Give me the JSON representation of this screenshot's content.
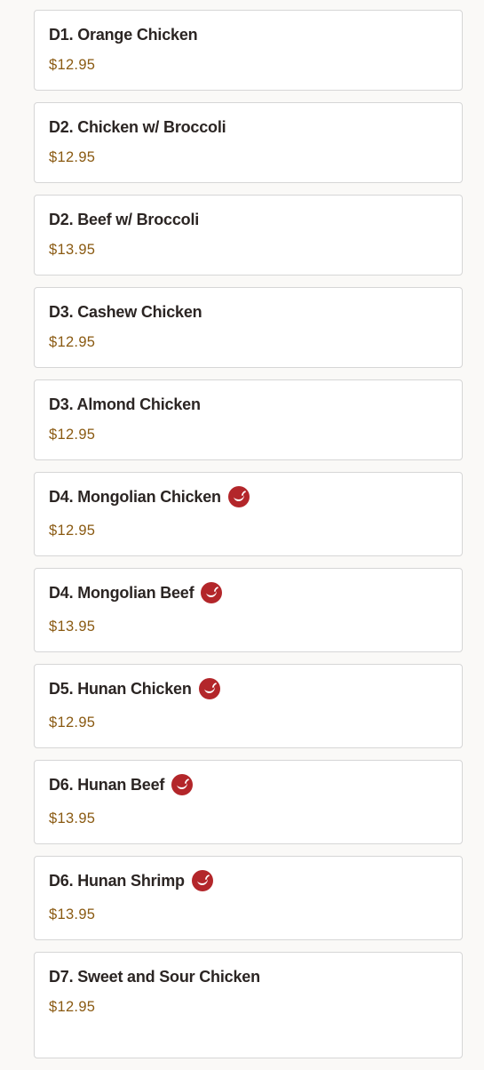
{
  "colors": {
    "background": "#faf9f7",
    "card_border": "#d6d6d6",
    "title_text": "#2b2523",
    "price_text": "#8a5a12",
    "spicy_badge": "#b3262a"
  },
  "menu": {
    "items": [
      {
        "name": "D1. Orange Chicken",
        "price": "$12.95",
        "spicy": false,
        "icon": null
      },
      {
        "name": "D2. Chicken w/ Broccoli",
        "price": "$12.95",
        "spicy": false,
        "icon": null
      },
      {
        "name": "D2. Beef w/ Broccoli",
        "price": "$13.95",
        "spicy": false,
        "icon": null
      },
      {
        "name": "D3. Cashew Chicken",
        "price": "$12.95",
        "spicy": false,
        "icon": null
      },
      {
        "name": "D3. Almond Chicken",
        "price": "$12.95",
        "spicy": false,
        "icon": null
      },
      {
        "name": "D4. Mongolian Chicken",
        "price": "$12.95",
        "spicy": true,
        "icon": "chili-pepper-icon"
      },
      {
        "name": "D4. Mongolian Beef",
        "price": "$13.95",
        "spicy": true,
        "icon": "chili-pepper-icon"
      },
      {
        "name": "D5. Hunan Chicken",
        "price": "$12.95",
        "spicy": true,
        "icon": "chili-pepper-icon"
      },
      {
        "name": "D6. Hunan Beef",
        "price": "$13.95",
        "spicy": true,
        "icon": "chili-pepper-icon"
      },
      {
        "name": "D6. Hunan Shrimp",
        "price": "$13.95",
        "spicy": true,
        "icon": "chili-pepper-icon"
      },
      {
        "name": "D7. Sweet and Sour Chicken",
        "price": "$12.95",
        "spicy": false,
        "icon": null
      }
    ]
  }
}
